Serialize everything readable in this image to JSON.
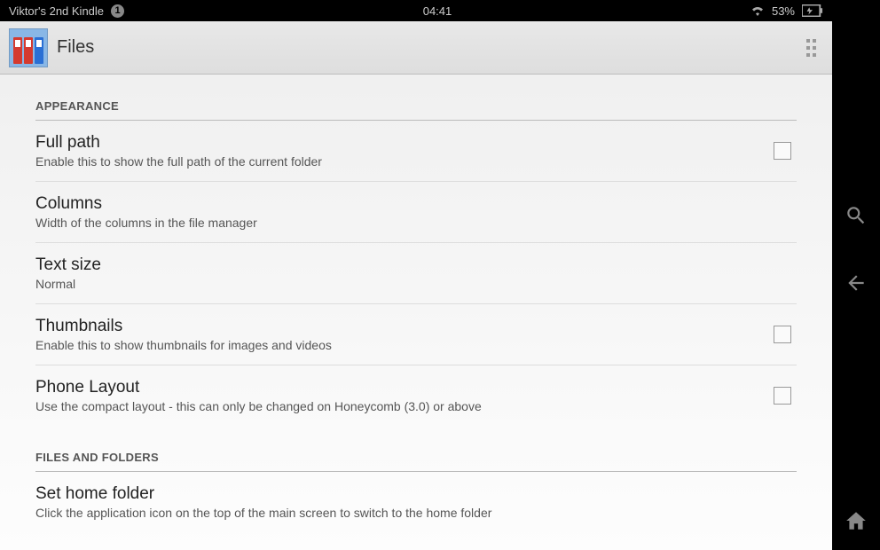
{
  "statusbar": {
    "device": "Viktor's 2nd Kindle",
    "badge": "1",
    "time": "04:41",
    "battery": "53%"
  },
  "actionbar": {
    "title": "Files"
  },
  "sections": {
    "appearance": {
      "header": "APPEARANCE",
      "items": [
        {
          "title": "Full path",
          "sub": "Enable this to show the full path of the current folder",
          "checkbox": true
        },
        {
          "title": "Columns",
          "sub": "Width of the columns in the file manager",
          "checkbox": false
        },
        {
          "title": "Text size",
          "sub": "Normal",
          "checkbox": false
        },
        {
          "title": "Thumbnails",
          "sub": "Enable this to show thumbnails for images and videos",
          "checkbox": true
        },
        {
          "title": "Phone Layout",
          "sub": "Use the compact layout - this can only be changed on Honeycomb (3.0) or above",
          "checkbox": true
        }
      ]
    },
    "filesfolders": {
      "header": "FILES AND FOLDERS",
      "items": [
        {
          "title": "Set home folder",
          "sub": "Click the application icon on the top of the main screen to switch to the home folder",
          "checkbox": false
        }
      ]
    }
  }
}
